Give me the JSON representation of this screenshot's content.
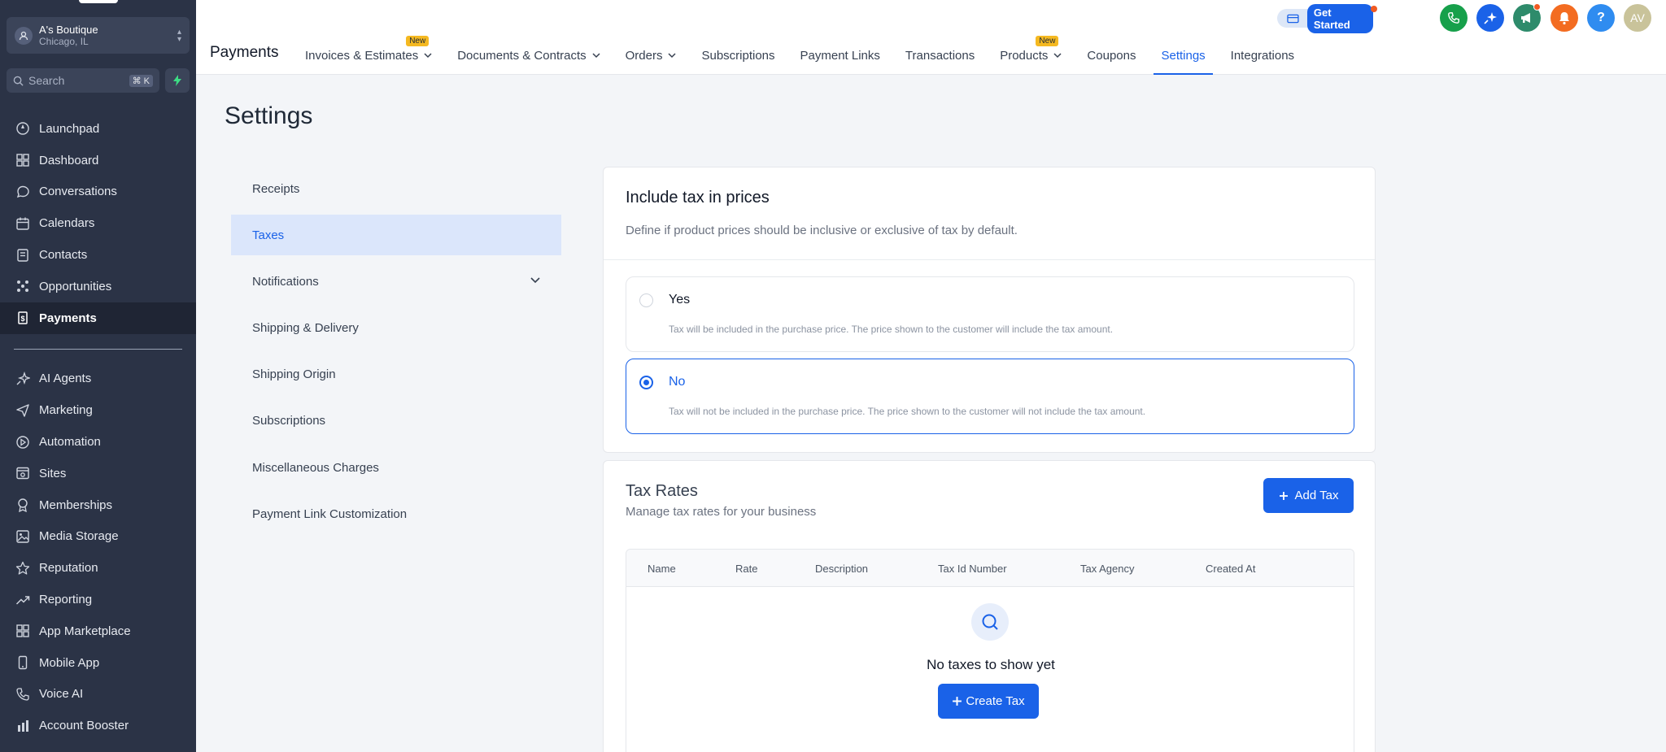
{
  "account": {
    "name": "A's Boutique",
    "location": "Chicago, IL"
  },
  "search": {
    "placeholder": "Search",
    "shortcut": "⌘ K"
  },
  "sidebar": {
    "items_top": [
      {
        "label": "Launchpad",
        "icon": "rocket-icon"
      },
      {
        "label": "Dashboard",
        "icon": "grid-icon"
      },
      {
        "label": "Conversations",
        "icon": "chat-icon"
      },
      {
        "label": "Calendars",
        "icon": "calendar-icon"
      },
      {
        "label": "Contacts",
        "icon": "contacts-icon"
      },
      {
        "label": "Opportunities",
        "icon": "opportunities-icon"
      },
      {
        "label": "Payments",
        "icon": "payments-icon",
        "active": true
      }
    ],
    "items_bottom": [
      {
        "label": "AI Agents",
        "icon": "sparkle-icon"
      },
      {
        "label": "Marketing",
        "icon": "send-icon"
      },
      {
        "label": "Automation",
        "icon": "automation-icon"
      },
      {
        "label": "Sites",
        "icon": "sites-icon"
      },
      {
        "label": "Memberships",
        "icon": "membership-icon"
      },
      {
        "label": "Media Storage",
        "icon": "image-icon"
      },
      {
        "label": "Reputation",
        "icon": "star-icon"
      },
      {
        "label": "Reporting",
        "icon": "trend-icon"
      },
      {
        "label": "App Marketplace",
        "icon": "apps-icon"
      },
      {
        "label": "Mobile App",
        "icon": "mobile-icon"
      },
      {
        "label": "Voice AI",
        "icon": "phone-icon"
      },
      {
        "label": "Account Booster",
        "icon": "booster-icon"
      }
    ]
  },
  "header": {
    "get_started": "Get Started",
    "avatar_initials": "AV",
    "help": "?",
    "app_title": "Payments",
    "tabs": [
      {
        "label": "Invoices & Estimates",
        "dropdown": true,
        "badge": "New"
      },
      {
        "label": "Documents & Contracts",
        "dropdown": true
      },
      {
        "label": "Orders",
        "dropdown": true
      },
      {
        "label": "Subscriptions"
      },
      {
        "label": "Payment Links"
      },
      {
        "label": "Transactions"
      },
      {
        "label": "Products",
        "dropdown": true,
        "badge": "New"
      },
      {
        "label": "Coupons"
      },
      {
        "label": "Settings",
        "active": true
      },
      {
        "label": "Integrations"
      }
    ]
  },
  "page_title": "Settings",
  "settings_menu": [
    {
      "label": "Receipts"
    },
    {
      "label": "Taxes",
      "active": true
    },
    {
      "label": "Notifications",
      "expandable": true
    },
    {
      "label": "Shipping & Delivery"
    },
    {
      "label": "Shipping Origin"
    },
    {
      "label": "Subscriptions"
    },
    {
      "label": "Miscellaneous Charges"
    },
    {
      "label": "Payment Link Customization"
    }
  ],
  "tax_inclusion": {
    "title": "Include tax in prices",
    "description": "Define if product prices should be inclusive or exclusive of tax by default.",
    "options": [
      {
        "label": "Yes",
        "description": "Tax will be included in the purchase price. The price shown to the customer will include the tax amount.",
        "selected": false
      },
      {
        "label": "No",
        "description": "Tax will not be included in the purchase price. The price shown to the customer will not include the tax amount.",
        "selected": true
      }
    ]
  },
  "tax_rates": {
    "title": "Tax Rates",
    "subtitle": "Manage tax rates for your business",
    "add_button": "Add Tax",
    "columns": [
      "Name",
      "Rate",
      "Description",
      "Tax Id Number",
      "Tax Agency",
      "Created At"
    ],
    "empty_text": "No taxes to show yet",
    "create_button": "Create Tax"
  },
  "colors": {
    "accent": "#1a62e8",
    "sidebar_bg": "#2b3346",
    "badge": "#f5b921"
  }
}
